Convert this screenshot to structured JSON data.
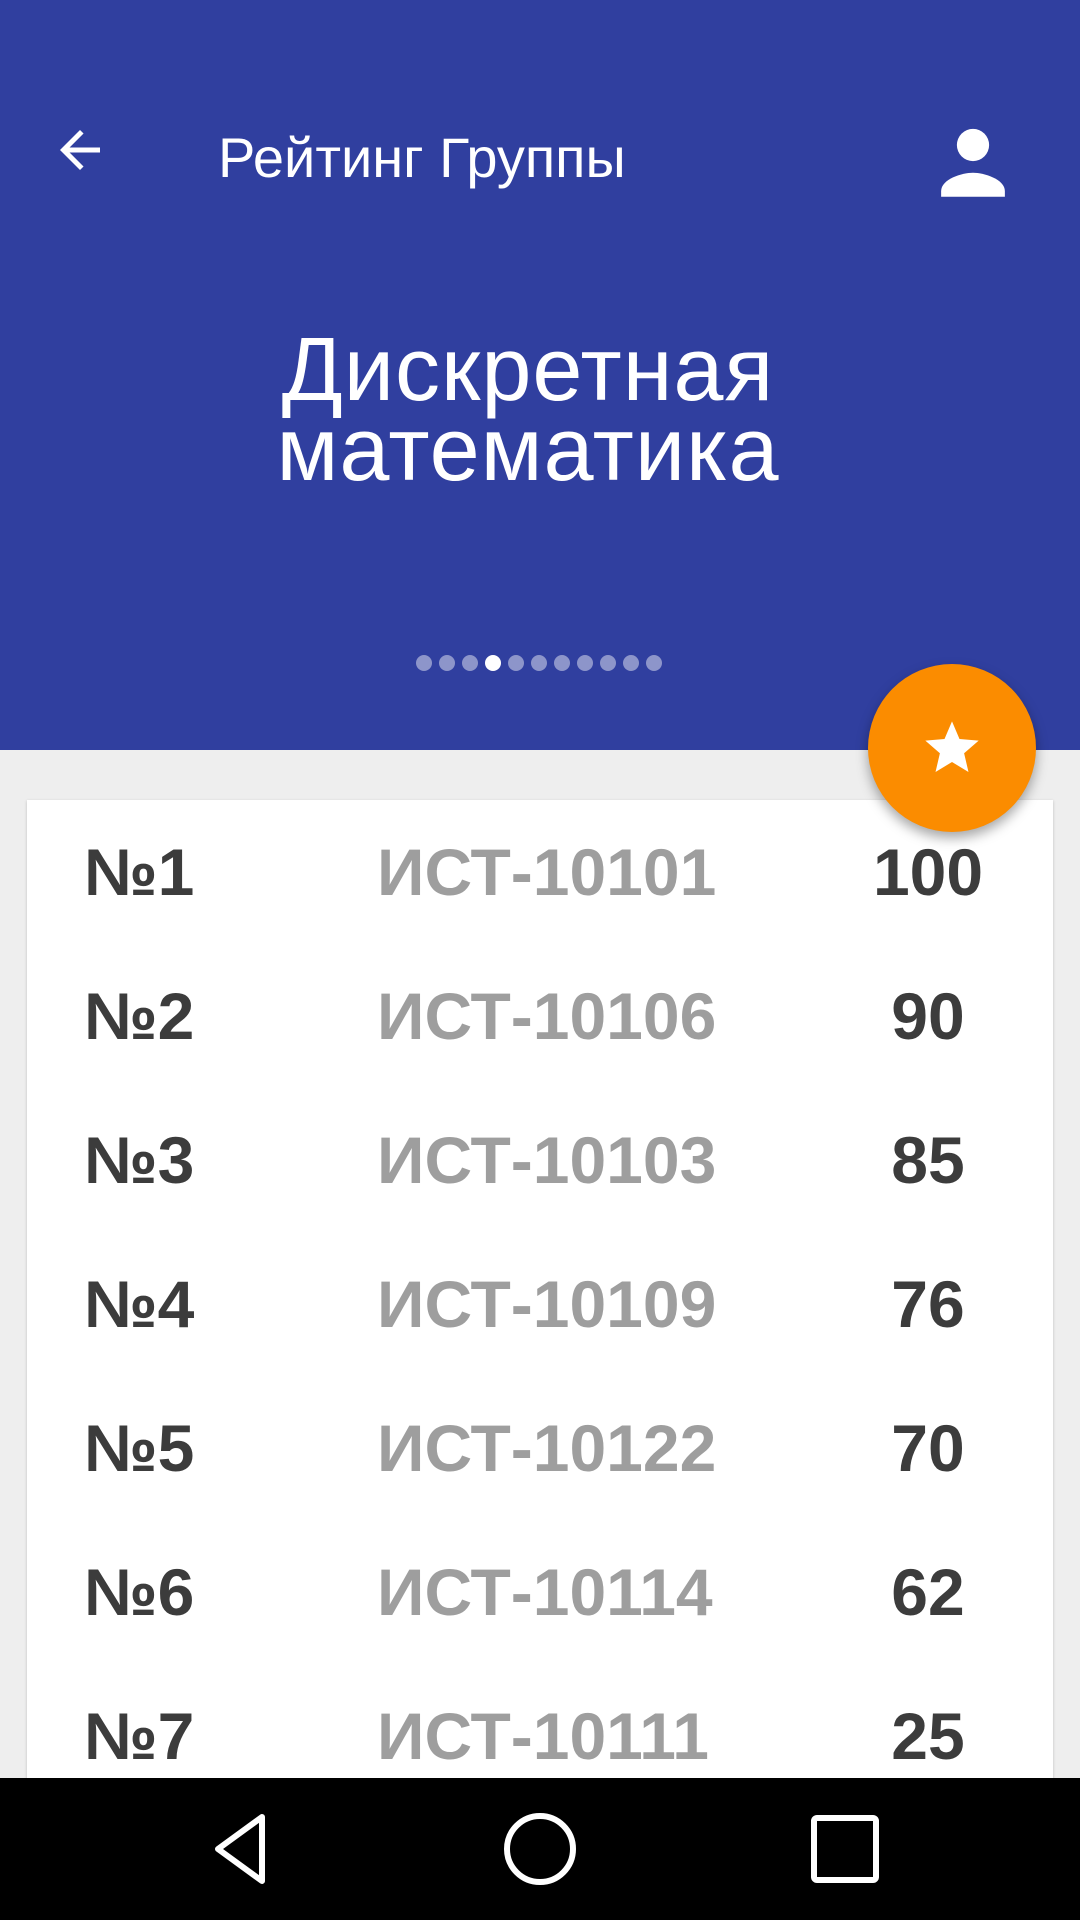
{
  "toolbar": {
    "title": "Рейтинг Группы",
    "back_icon": "arrow-back-icon",
    "profile_icon": "person-icon"
  },
  "subject": {
    "line1": "Дискретная",
    "line2": "математика"
  },
  "pager": {
    "total": 11,
    "active_index": 3
  },
  "fab": {
    "icon": "star-icon"
  },
  "ranking": [
    {
      "rank": "№1",
      "group": "ИСТ-10101",
      "score": "100"
    },
    {
      "rank": "№2",
      "group": "ИСТ-10106",
      "score": "90"
    },
    {
      "rank": "№3",
      "group": "ИСТ-10103",
      "score": "85"
    },
    {
      "rank": "№4",
      "group": "ИСТ-10109",
      "score": "76"
    },
    {
      "rank": "№5",
      "group": "ИСТ-10122",
      "score": "70"
    },
    {
      "rank": "№6",
      "group": "ИСТ-10114",
      "score": "62"
    },
    {
      "rank": "№7",
      "group": "ИСТ-10111",
      "score": "25"
    }
  ],
  "colors": {
    "primary": "#303f9f",
    "accent": "#fb8c00",
    "background": "#eeeeee"
  },
  "navbar": {
    "back_icon": "nav-back-icon",
    "home_icon": "nav-home-icon",
    "recents_icon": "nav-recents-icon"
  }
}
